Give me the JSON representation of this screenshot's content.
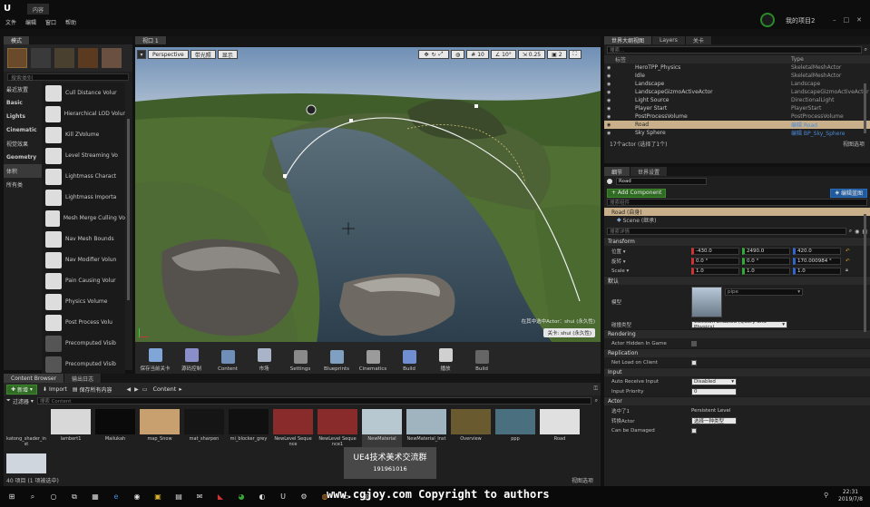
{
  "titlebar": {
    "app_tab": "内容",
    "project_name": "我的项目2",
    "user_badge": "●"
  },
  "menubar": [
    "文件",
    "编辑",
    "窗口",
    "帮助"
  ],
  "modes": {
    "tab": "模式",
    "search_placeholder": "搜索类别",
    "categories": [
      "最近放置",
      "Basic",
      "Lights",
      "Cinematic",
      "视觉效果",
      "Geometry",
      "体积",
      "所有类"
    ],
    "items": [
      "Cull Distance Volur",
      "Hierarchical LOD Volur",
      "Kill ZVolume",
      "Level Streaming Vo",
      "Lightmass Charact",
      "Lightmass Importa",
      "Mesh Merge Culling Vo",
      "Nav Mesh Bounds",
      "Nav Modifier Volun",
      "Pain Causing Volur",
      "Physics Volume",
      "Post Process Volu",
      "Precomputed Visib",
      "Precomputed Visib"
    ]
  },
  "viewport": {
    "tab": "视口 1",
    "perspective": "Perspective",
    "lit": "带光照",
    "show": "显示",
    "grid_snap": "10",
    "rot_snap": "10°",
    "scale_snap": "0.25",
    "cam_speed": "2",
    "overlay_line1": "在其中选中Actor：shui (永久性)",
    "overlay_line2": "关卡: shui (永久性)"
  },
  "toolbar": [
    {
      "label": "保存当前关卡",
      "color": "#7fa6d6"
    },
    {
      "label": "源码控制",
      "color": "#8a8fc9"
    },
    {
      "label": "Content",
      "color": "#6f8fb8"
    },
    {
      "label": "市场",
      "color": "#aab4c8"
    },
    {
      "label": "Settings",
      "color": "#8a8a8a"
    },
    {
      "label": "Blueprints",
      "color": "#7fa0c0"
    },
    {
      "label": "Cinematics",
      "color": "#9b9b9b"
    },
    {
      "label": "Build",
      "color": "#6f8fd0"
    },
    {
      "label": "播放",
      "color": "#d0d0d0"
    },
    {
      "label": "Build",
      "color": "#666"
    }
  ],
  "outliner": {
    "tabs": [
      "世界大纲视图",
      "Layers",
      "关卡"
    ],
    "search_placeholder": "搜索...",
    "col_label": "标签",
    "col_type": "Type",
    "rows": [
      {
        "label": "HeroTPP_Physics",
        "type": "SkeletalMeshActor"
      },
      {
        "label": "Idle",
        "type": "SkeletalMeshActor"
      },
      {
        "label": "Landscape",
        "type": "Landscape"
      },
      {
        "label": "LandscapeGizmoActiveActor",
        "type": "LandscapeGizmoActiveActor"
      },
      {
        "label": "Light Source",
        "type": "DirectionalLight"
      },
      {
        "label": "Player Start",
        "type": "PlayerStart"
      },
      {
        "label": "PostProcessVolume",
        "type": "PostProcessVolume"
      },
      {
        "label": "Road",
        "type": "编辑 Road"
      },
      {
        "label": "Sky Sphere",
        "type": "编辑 BP_Sky_Sphere"
      }
    ],
    "status": "17个actor (选择了1个)",
    "view_options": "视图选项"
  },
  "details": {
    "tabs": [
      "细节",
      "世界设置"
    ],
    "name_value": "Road",
    "add_component": "+ Add Component",
    "edit_blueprint": "编辑蓝图",
    "comp_search_placeholder": "搜索组件",
    "comp_root": "Road (自身)",
    "comp_child": "Scene (继承)",
    "details_search_placeholder": "搜索详情",
    "transform_section": "Transform",
    "location_label": "位置",
    "location": [
      "-430.0",
      "2490.0",
      "420.0"
    ],
    "rotation_label": "旋转",
    "rotation": [
      "0.0 °",
      "0.0 °",
      "170.000984 °"
    ],
    "scale_label": "Scale",
    "scale": [
      "1.0",
      "1.0",
      "1.0"
    ],
    "default_section": "默认",
    "mesh_label": "模型",
    "mesh_value": "pipe",
    "collision_label": "碰撞类型",
    "collision_value": "Collision Enabled (Query and Physics)",
    "rendering_section": "Rendering",
    "hidden_label": "Actor Hidden In Game",
    "replication_section": "Replication",
    "netload_label": "Net Load on Client",
    "input_section": "Input",
    "autoreceive_label": "Auto Receive Input",
    "autoreceive_value": "Disabled",
    "priority_label": "Input Priority",
    "priority_value": "0",
    "actor_section": "Actor",
    "selected_label": "选中了1",
    "selected_value": "Persistent Level",
    "convert_label": "转换Actor",
    "convert_value": "选择一种类型",
    "canbedamaged_label": "Can be Damaged"
  },
  "content_browser": {
    "tabs": [
      "Content Browser",
      "输出日志"
    ],
    "new_label": "新增",
    "import_label": "Import",
    "save_all_label": "保存所有内容",
    "path_label": "Content",
    "filter_label": "过滤器",
    "search_placeholder": "搜索 Content",
    "assets": [
      {
        "name": "katong_shader_inst",
        "color": "#202020"
      },
      {
        "name": "lambert1",
        "color": "#d8d8d8"
      },
      {
        "name": "Mailukah",
        "color": "#0a0a0a"
      },
      {
        "name": "map_Snow",
        "color": "#c8a070"
      },
      {
        "name": "mat_sharpen",
        "color": "#151515"
      },
      {
        "name": "mi_blocker_grey",
        "color": "#101010"
      },
      {
        "name": "NewLevel Sequence",
        "color": "#8a2b2b"
      },
      {
        "name": "NewLevel Sequence1",
        "color": "#8a2b2b"
      },
      {
        "name": "NewMaterial",
        "color": "#b8c8d0"
      },
      {
        "name": "NewMaterial_Inst",
        "color": "#a0b4c0"
      },
      {
        "name": "Overview",
        "color": "#6a5a30"
      },
      {
        "name": "ppp",
        "color": "#4a7080"
      },
      {
        "name": "Road",
        "color": "#e0e0e0"
      }
    ],
    "status": "40 项目 (1 项被选中)",
    "view_options": "视图选项"
  },
  "watermark": {
    "group_title": "UE4技术美术交流群",
    "group_number": "191961016",
    "copyright": "www.cgjoy.com Copyright to authors"
  },
  "taskbar": {
    "time": "22:31",
    "date": "2019/7/8"
  }
}
